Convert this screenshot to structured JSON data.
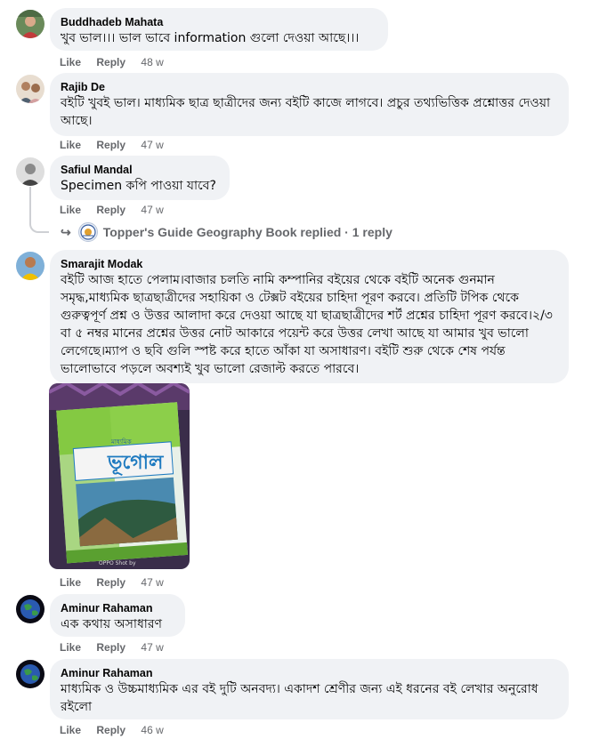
{
  "comments": [
    {
      "author": "Buddhadeb Mahata",
      "text": "খুব ভাল।।। ভাল ভাবে information গুলো দেওয়া আছে।।।",
      "like": "Like",
      "reply": "Reply",
      "time": "48 w"
    },
    {
      "author": "Rajib De",
      "text": "বইটি খুবই ভাল। মাধ্যমিক ছাত্র ছাত্রীদের জন্য বইটি কাজে লাগবে। প্রচুর তথ্যভিত্তিক প্রশ্নোত্তর দেওয়া আছে।",
      "like": "Like",
      "reply": "Reply",
      "time": "47 w"
    },
    {
      "author": "Safiul Mandal",
      "text": "Specimen কপি পাওয়া যাবে?",
      "like": "Like",
      "reply": "Reply",
      "time": "47 w",
      "replies_link": "Topper's Guide Geography Book replied · 1 reply"
    },
    {
      "author": "Smarajit Modak",
      "text": "বইটি আজ হাতে পেলাম।বাজার চলতি নামি কম্পানির বইয়ের থেকে বইটি অনেক গুনমান সমৃদ্ধ,মাধ্যমিক ছাত্রছাত্রীদের সহায়িকা ও টেক্সট বইয়ের চাহিদা পূরণ করবে। প্রতিটি টপিক থেকে গুরুত্বপূর্ণ প্রশ্ন ও উত্তর আলাদা করে দেওয়া আছে যা ছাত্রছাত্রীদের শর্ট প্রশ্নের চাহিদা পূরণ করবে।২/৩ বা ৫ নম্বর মানের প্রশ্নের উত্তর নোট আকারে পয়েন্ট করে উত্তর লেখা আছে যা আমার খুব ভালো লেগেছে।ম্যাপ ও ছবি গুলি স্পষ্ট করে হাতে আঁকা যা অসাধারণ। বইটি শুরু থেকে শেষ পর্যন্ত ভালোভাবে পড়লে অবশ্যই খুব ভালো রেজাল্ট করতে পারবে।",
      "like": "Like",
      "reply": "Reply",
      "time": "47 w",
      "photo": {
        "book_small_title": "মাধ্যমিক",
        "book_title": "ভূগোল",
        "footer": "OPPO Shot by"
      }
    },
    {
      "author": "Aminur Rahaman",
      "text": "এক কথায় অসাধারণ",
      "like": "Like",
      "reply": "Reply",
      "time": "47 w"
    },
    {
      "author": "Aminur Rahaman",
      "text": "মাধ্যমিক ও উচ্চমাধ্যমিক এর বই দুটি অনবদ্য। একাদশ শ্রেণীর জন্য এই ধরনের বই লেখার অনুরোধ রইলো",
      "like": "Like",
      "reply": "Reply",
      "time": "46 w"
    }
  ]
}
